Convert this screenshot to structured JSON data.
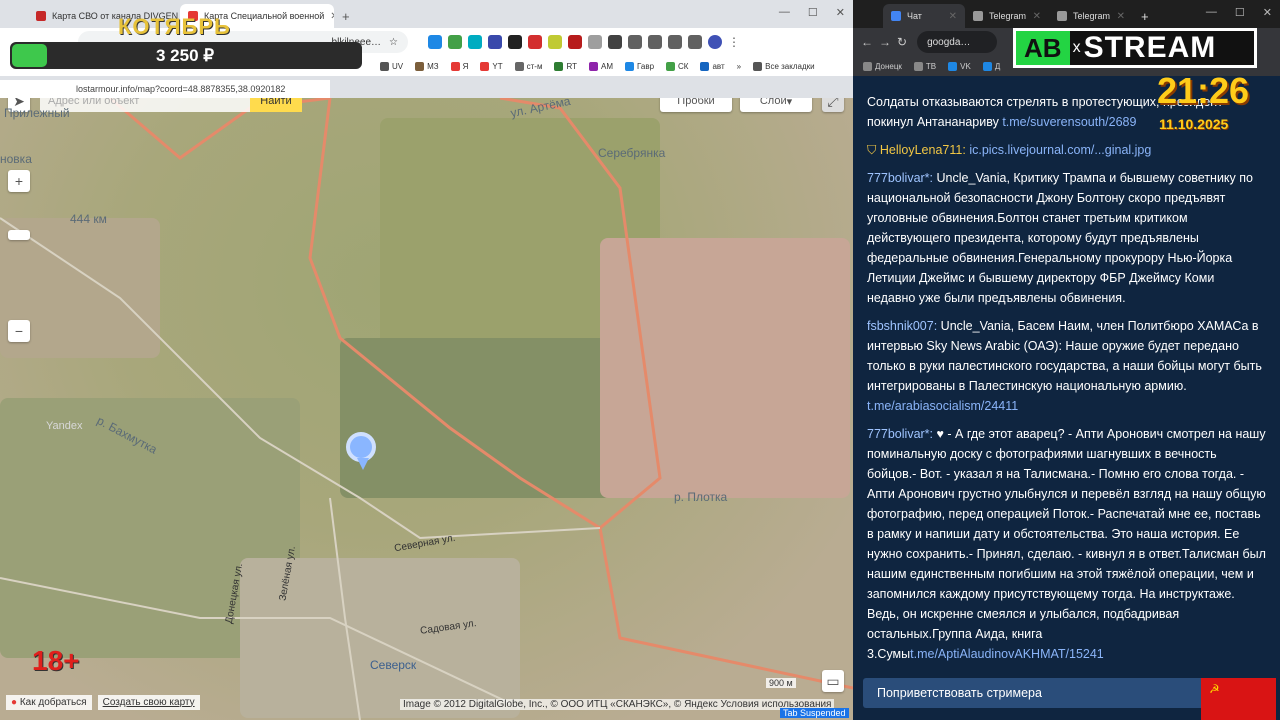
{
  "left_browser": {
    "tabs": [
      {
        "label": "Карта СВО от канала DIVGEN",
        "color": "#c62828"
      },
      {
        "label": "Карта Специальной военной",
        "color": "#e53935"
      }
    ],
    "omnibox_text": "…blkilneee…",
    "bookmarks": [
      {
        "label": "UV",
        "color": "#555"
      },
      {
        "label": "МЗ",
        "color": "#7b5e3b"
      },
      {
        "label": "Я",
        "color": "#e53935"
      },
      {
        "label": "YT",
        "color": "#e53935"
      },
      {
        "label": "ст-м",
        "color": "#666"
      },
      {
        "label": "RT",
        "color": "#2e7d32"
      },
      {
        "label": "АМ",
        "color": "#8e24aa"
      },
      {
        "label": "Гавр",
        "color": "#1e88e5"
      },
      {
        "label": "СК",
        "color": "#43a047"
      },
      {
        "label": "авт",
        "color": "#1565c0"
      },
      {
        "label": "Все закладки",
        "color": "#555"
      }
    ],
    "page_url": "lostarmour.info/map?coord=48.8878355,38.0920182"
  },
  "map": {
    "search_placeholder": "Адрес или объект",
    "find_label": "Найти",
    "traffic_label": "Пробки",
    "layers_label": "Слои",
    "labels": {
      "prilezh": "Прилежный",
      "novka": "новка",
      "serebryanka": "Серебрянка",
      "artema": "ул. Артёма",
      "distance": "444 км",
      "bakhmutka": "р. Бахмутка",
      "plotka": "р. Плотка",
      "severnaya": "Северная ул.",
      "sadovaya": "Садовая ул.",
      "donetskaya": "Донецкая ул.",
      "zelenaya": "Зелёная ул.",
      "seversk": "Северск",
      "yandex": "Yandex"
    },
    "route_label": "Как добраться",
    "create_map_label": "Создать свою карту",
    "copyright": "Image © 2012 DigitalGlobe, Inc., © ООО ИТЦ «СКАНЭКС», © Яндекс Условия использования",
    "scale": "900 м",
    "tab_suspended": "Tab Suspended"
  },
  "stream_overlay": {
    "goal_title": "КОТЯБРЬ",
    "goal_amount": "3 250 ₽",
    "goal_progress": 0.1,
    "age_rating": "18+",
    "logo_ab": "AB",
    "logo_x": "x",
    "logo_stream": "STREAM",
    "clock": "21:26",
    "date": "11.10.2025"
  },
  "right_browser": {
    "tabs": [
      {
        "label": "Чат",
        "color": "#4285f4"
      },
      {
        "label": "Telegram",
        "color": "#999"
      },
      {
        "label": "Telegram",
        "color": "#999"
      }
    ],
    "omnibox_text": "googda…",
    "bookmarks": [
      {
        "label": "Донецк",
        "color": "#888"
      },
      {
        "label": "ТВ",
        "color": "#888"
      },
      {
        "label": "VK",
        "color": "#1e88e5"
      },
      {
        "label": "Д",
        "color": "#1e88e5"
      }
    ]
  },
  "chat": {
    "messages": [
      {
        "nick": "",
        "text": "Солдаты отказываются стрелять в протестующих, президент покинул Антананариву ",
        "link": "t.me/suverensouth/2689"
      },
      {
        "nick": "HelloyLena711:",
        "text": " ",
        "link": "ic.pics.livejournal.com/...ginal.jpg"
      },
      {
        "nick": "777bolivar*:",
        "text": " Uncle_Vania, Критику Трампа и бывшему советнику по национальной безопасности Джону Болтону скоро предъявят уголовные обвинения.Болтон станет третьим критиком действующего президента, которому будут предъявлены федеральные обвинения.Генеральному прокурору Нью-Йорка Летиции Джеймс и бывшему директору ФБР Джеймсу Коми недавно уже были предъявлены обвинения.",
        "link": ""
      },
      {
        "nick": "fsbshnik007:",
        "text": " Uncle_Vania, Басем Наим, член Политбюро ХАМАСа в интервью Sky News Arabic (ОАЭ): Наше оружие будет передано только в руки палестинского государства, а наши бойцы могут быть интегрированы в Палестинскую национальную армию. ",
        "link": "t.me/arabiasocialism/24411"
      },
      {
        "nick": "777bolivar*:",
        "text": " ♥ - А где этот аварец? - Апти Аронович смотрел на нашу поминальную доску с фотографиями шагнувших в вечность бойцов.- Вот. - указал я на Талисмана.- Помню его слова тогда. - Апти Аронович грустно улыбнулся и перевёл взгляд на нашу общую фотографию, перед операцией Поток.- Распечатай мне ее, поставь в рамку и напиши дату и обстоятельства. Это наша история. Ее нужно сохранить.- Принял, сделаю. - кивнул я в ответ.Талисман был нашим единственным погибшим на этой тяжёлой операции, чем и запомнился каждому присутствующему тогда. На инструктаже. Ведь, он искренне смеялся и улыбался, подбадривая остальных.Группа Аида, книга 3.Сумы",
        "link": "t.me/AptiAlaudinovAKHMAT/15241"
      }
    ],
    "greet_button": "Поприветствовать стримера",
    "flag_symbol": "☭"
  }
}
